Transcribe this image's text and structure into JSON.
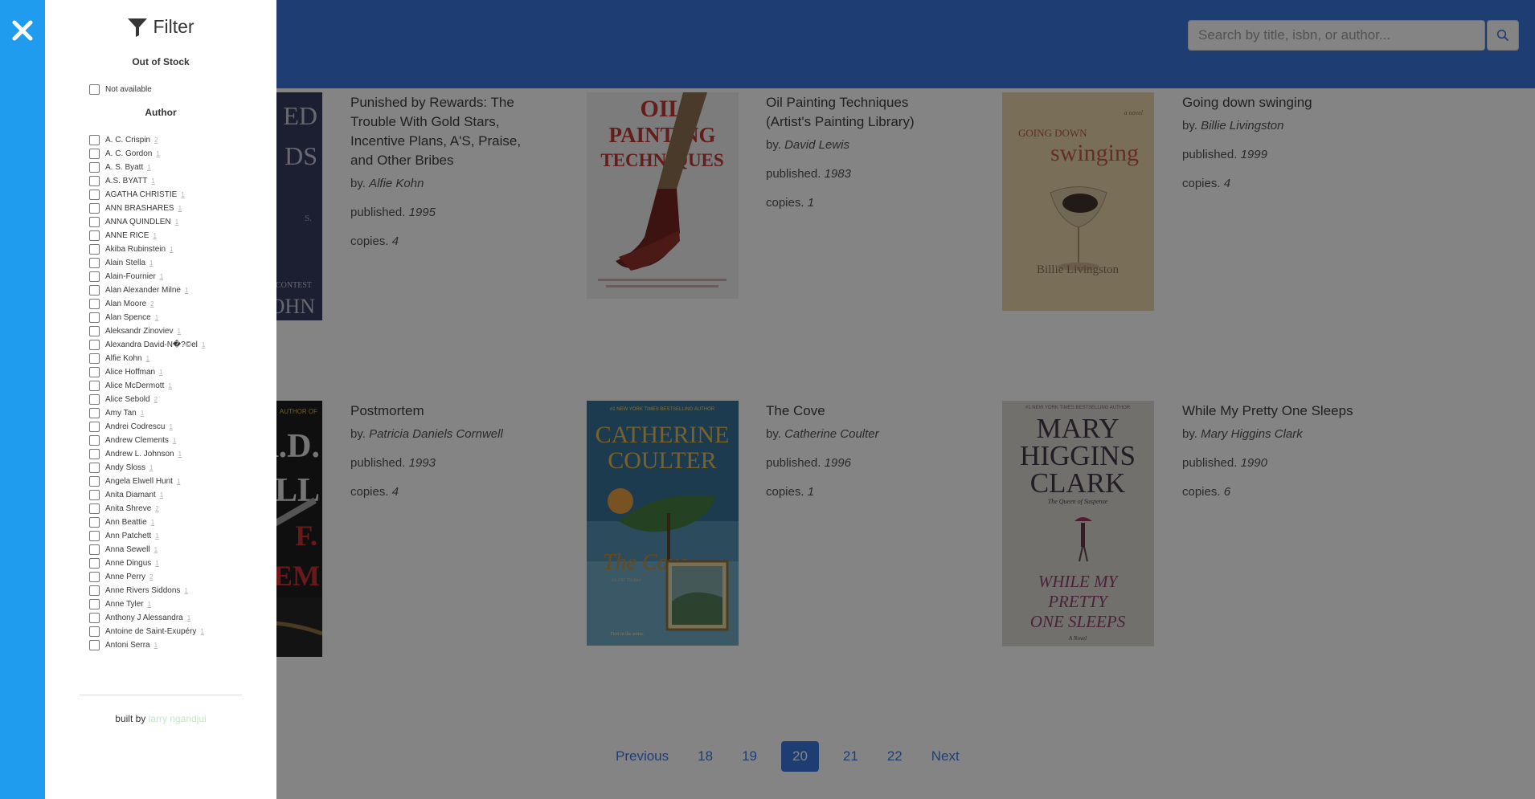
{
  "header": {
    "search_placeholder": "Search by title, isbn, or author..."
  },
  "books": [
    {
      "title": "Punished by Rewards: The Trouble With Gold Stars, Incentive Plans, A'S, Praise, and Other Bribes",
      "by_prefix": "by.",
      "author": "Alfie Kohn",
      "published_prefix": "published.",
      "published": "1995",
      "copies_prefix": "copies.",
      "copies": "4",
      "cover_text": [
        "ED",
        "DS",
        "S.",
        "CONTEST",
        "OHN"
      ]
    },
    {
      "title": "Oil Painting Techniques (Artist's Painting Library)",
      "by_prefix": "by.",
      "author": "David Lewis",
      "published_prefix": "published.",
      "published": "1983",
      "copies_prefix": "copies.",
      "copies": "1",
      "cover_text": [
        "OIL",
        "PAINTING",
        "TECHNIQUES"
      ]
    },
    {
      "title": "Going down swinging",
      "by_prefix": "by.",
      "author": "Billie Livingston",
      "published_prefix": "published.",
      "published": "1999",
      "copies_prefix": "copies.",
      "copies": "4",
      "cover_text": [
        "a novel",
        "GOING DOWN",
        "swinging",
        "Billie Livingston"
      ]
    },
    {
      "title": "Postmortem",
      "by_prefix": "by.",
      "author": "Patricia Daniels Cornwell",
      "published_prefix": "published.",
      "published": "1993",
      "copies_prefix": "copies.",
      "copies": "4",
      "cover_text": [
        "AUTHOR OF",
        "A.D.",
        "ELL",
        "F.",
        "EM"
      ]
    },
    {
      "title": "The Cove",
      "by_prefix": "by.",
      "author": "Catherine Coulter",
      "published_prefix": "published.",
      "published": "1996",
      "copies_prefix": "copies.",
      "copies": "1",
      "cover_text": [
        "#1 NEW YORK TIMES BESTSELLING AUTHOR",
        "CATHERINE",
        "COULTER",
        "The Cove",
        "An FBI Thriller",
        "First in the series"
      ]
    },
    {
      "title": "While My Pretty One Sleeps",
      "by_prefix": "by.",
      "author": "Mary Higgins Clark",
      "published_prefix": "published.",
      "published": "1990",
      "copies_prefix": "copies.",
      "copies": "6",
      "cover_text": [
        "#1 NEW YORK TIMES BESTSELLING AUTHOR",
        "MARY",
        "HIGGINS",
        "CLARK",
        "The Queen of Suspense",
        "WHILE MY",
        "PRETTY",
        "ONE SLEEPS",
        "A Novel"
      ]
    }
  ],
  "pagination": {
    "previous": "Previous",
    "pages": [
      "18",
      "19",
      "20",
      "21",
      "22"
    ],
    "current": "20",
    "next": "Next"
  },
  "sidebar": {
    "title": "Filter",
    "out_of_stock_heading": "Out of Stock",
    "not_available_label": "Not available",
    "author_heading": "Author",
    "authors": [
      {
        "name": "A. C. Crispin",
        "count": "2"
      },
      {
        "name": "A. C. Gordon",
        "count": "1"
      },
      {
        "name": "A. S. Byatt",
        "count": "1"
      },
      {
        "name": "A.S. BYATT",
        "count": "1"
      },
      {
        "name": "AGATHA CHRISTIE",
        "count": "1"
      },
      {
        "name": "ANN BRASHARES",
        "count": "1"
      },
      {
        "name": "ANNA QUINDLEN",
        "count": "1"
      },
      {
        "name": "ANNE RICE",
        "count": "1"
      },
      {
        "name": "Akiba Rubinstein",
        "count": "1"
      },
      {
        "name": "Alain Stella",
        "count": "1"
      },
      {
        "name": "Alain-Fournier",
        "count": "1"
      },
      {
        "name": "Alan Alexander Milne",
        "count": "1"
      },
      {
        "name": "Alan Moore",
        "count": "2"
      },
      {
        "name": "Alan Spence",
        "count": "1"
      },
      {
        "name": "Aleksandr Zinoviev",
        "count": "1"
      },
      {
        "name": "Alexandra David-N�?©el",
        "count": "1"
      },
      {
        "name": "Alfie Kohn",
        "count": "1"
      },
      {
        "name": "Alice Hoffman",
        "count": "1"
      },
      {
        "name": "Alice McDermott",
        "count": "1"
      },
      {
        "name": "Alice Sebold",
        "count": "2"
      },
      {
        "name": "Amy Tan",
        "count": "1"
      },
      {
        "name": "Andrei Codrescu",
        "count": "1"
      },
      {
        "name": "Andrew Clements",
        "count": "1"
      },
      {
        "name": "Andrew L. Johnson",
        "count": "1"
      },
      {
        "name": "Andy Sloss",
        "count": "1"
      },
      {
        "name": "Angela Elwell Hunt",
        "count": "1"
      },
      {
        "name": "Anita Diamant",
        "count": "1"
      },
      {
        "name": "Anita Shreve",
        "count": "2"
      },
      {
        "name": "Ann Beattie",
        "count": "1"
      },
      {
        "name": "Ann Patchett",
        "count": "1"
      },
      {
        "name": "Anna Sewell",
        "count": "1"
      },
      {
        "name": "Anne Dingus",
        "count": "1"
      },
      {
        "name": "Anne Perry",
        "count": "2"
      },
      {
        "name": "Anne Rivers Siddons",
        "count": "1"
      },
      {
        "name": "Anne Tyler",
        "count": "1"
      },
      {
        "name": "Anthony J Alessandra",
        "count": "1"
      },
      {
        "name": "Antoine de Saint-Exupéry",
        "count": "1"
      },
      {
        "name": "Antoni Serra",
        "count": "1"
      }
    ],
    "built_by_prefix": "built by",
    "built_by_author": "larry ngandjui"
  }
}
